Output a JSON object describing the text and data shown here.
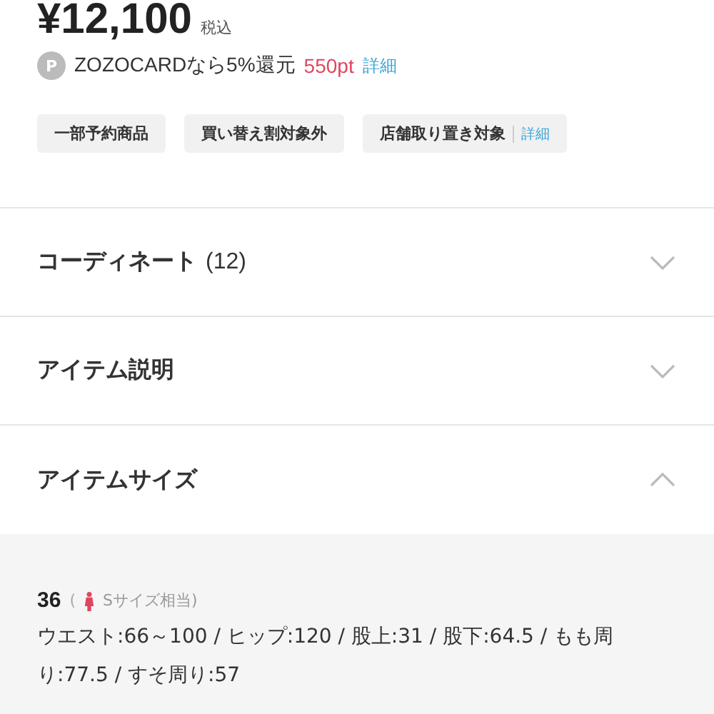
{
  "price": {
    "amount": "¥12,100",
    "tax": "税込"
  },
  "points": {
    "badge": "P",
    "text": "ZOZOCARDなら5%還元",
    "points": "550pt",
    "link": "詳細"
  },
  "tags": [
    {
      "label": "一部予約商品"
    },
    {
      "label": "買い替え割対象外"
    },
    {
      "label": "店舗取り置き対象",
      "link": "詳細"
    }
  ],
  "sections": [
    {
      "title": "コーディネート",
      "count": "(12)",
      "expanded": false
    },
    {
      "title": "アイテム説明",
      "expanded": false
    },
    {
      "title": "アイテムサイズ",
      "expanded": true,
      "sizes": [
        {
          "size": "36",
          "paren": "(",
          "equivalent": "Sサイズ相当)",
          "measurements": "ウエスト:66～100 / ヒップ:120 / 股上:31 / 股下:64.5 / もも周り:77.5 / すそ周り:57"
        }
      ]
    }
  ]
}
